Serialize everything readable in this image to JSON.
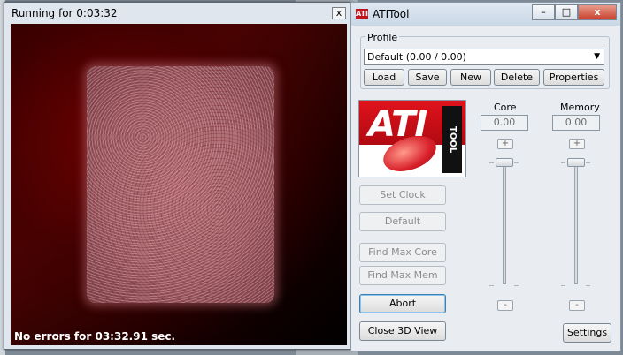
{
  "view_window": {
    "title": "Running for 0:03:32",
    "close_glyph": "x",
    "status": "No errors for 03:32.91 sec."
  },
  "ati_window": {
    "title": "ATITool",
    "icon_text": "ATI",
    "min_glyph": "–",
    "max_glyph": "□",
    "close_glyph": "x",
    "profile": {
      "group_label": "Profile",
      "selected": "Default (0.00 / 0.00)",
      "buttons": {
        "load": "Load",
        "save": "Save",
        "new": "New",
        "delete": "Delete",
        "properties": "Properties"
      }
    },
    "logo": {
      "text": "ATI",
      "subtext": "TOOL"
    },
    "core": {
      "label": "Core",
      "value": "0.00",
      "plus": "+",
      "minus": "-"
    },
    "memory": {
      "label": "Memory",
      "value": "0.00",
      "plus": "+",
      "minus": "-"
    },
    "buttons": {
      "set_clock": "Set Clock",
      "default": "Default",
      "find_max_core": "Find Max Core",
      "find_max_mem": "Find Max Mem",
      "abort": "Abort",
      "close_3d": "Close 3D View",
      "settings": "Settings"
    }
  }
}
